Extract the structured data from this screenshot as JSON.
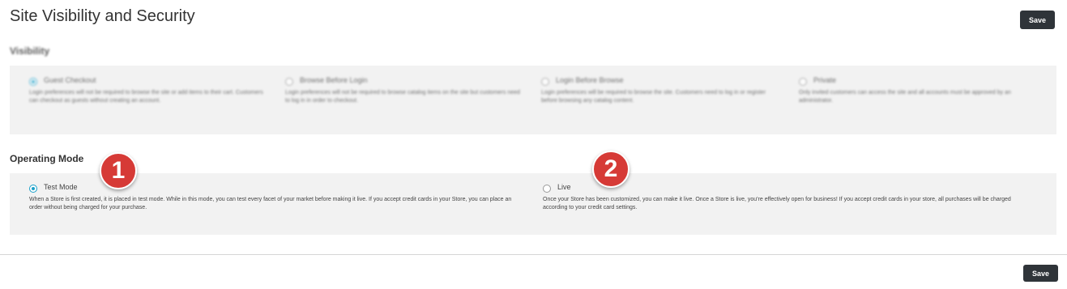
{
  "header": {
    "title": "Site Visibility and Security",
    "save_label": "Save"
  },
  "visibility": {
    "heading": "Visibility",
    "options": [
      {
        "label": "Guest Checkout",
        "checked": true,
        "desc": "Login preferences will not be required to browse the site or add items to their cart. Customers can checkout as guests without creating an account."
      },
      {
        "label": "Browse Before Login",
        "checked": false,
        "desc": "Login preferences will not be required to browse catalog items on the site but customers need to log in in order to checkout."
      },
      {
        "label": "Login Before Browse",
        "checked": false,
        "desc": "Login preferences will be required to browse the site. Customers need to log in or register before browsing any catalog content."
      },
      {
        "label": "Private",
        "checked": false,
        "desc": "Only invited customers can access the site and all accounts must be approved by an administrator."
      }
    ]
  },
  "operating_mode": {
    "heading": "Operating Mode",
    "options": [
      {
        "label": "Test Mode",
        "checked": true,
        "desc": "When a Store is first created, it is placed in test mode. While in this mode, you can test every facet of your market before making it live. If you accept credit cards in your Store, you can place an order without being charged for your purchase."
      },
      {
        "label": "Live",
        "checked": false,
        "desc": "Once your Store has been customized, you can make it live. Once a Store is live, you're effectively open for business! If you accept credit cards in your store, all purchases will be charged according to your credit card settings."
      }
    ]
  },
  "annotations": {
    "badge_1": "1",
    "badge_2": "2",
    "color": "#d63a36"
  },
  "footer": {
    "save_label": "Save"
  }
}
